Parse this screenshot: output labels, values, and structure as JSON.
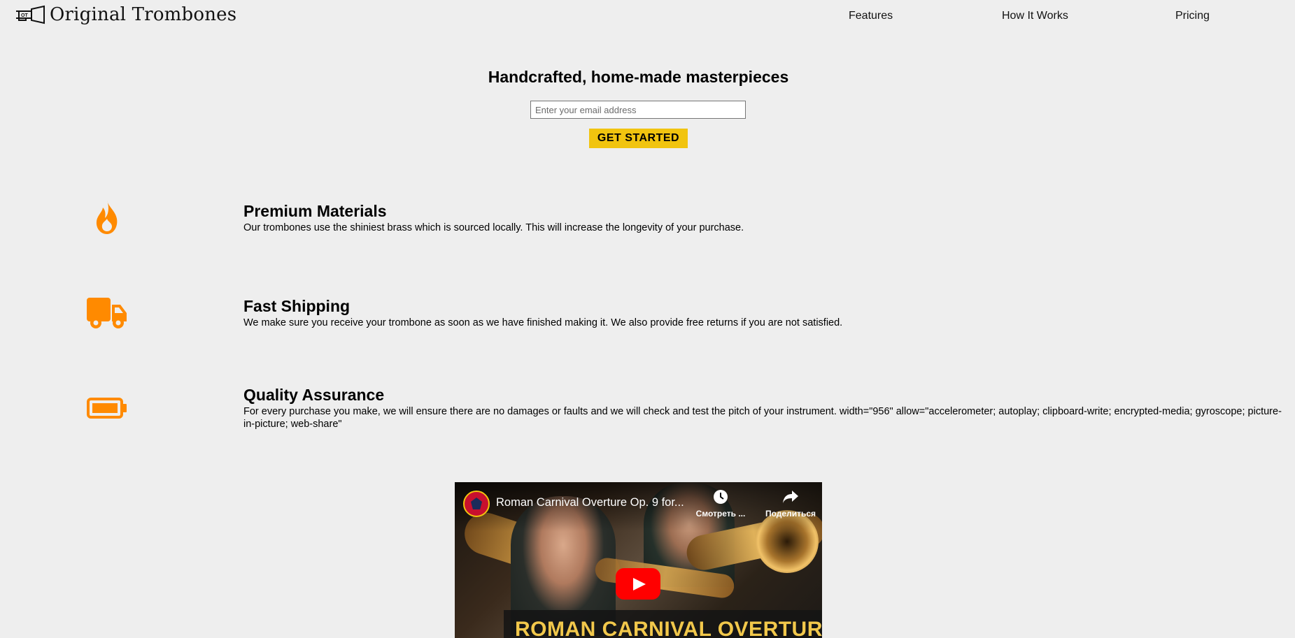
{
  "header": {
    "brand": "Original Trombones",
    "logo_icon": "trombone-icon",
    "nav": [
      {
        "label": "Features"
      },
      {
        "label": "How It Works"
      },
      {
        "label": "Pricing"
      }
    ]
  },
  "hero": {
    "title": "Handcrafted, home-made masterpieces",
    "email_placeholder": "Enter your email address",
    "cta_label": "GET STARTED",
    "cta_color": "#f1c40f"
  },
  "features": [
    {
      "icon": "fire-icon",
      "title": "Premium Materials",
      "text": "Our trombones use the shiniest brass which is sourced locally. This will increase the longevity of your purchase."
    },
    {
      "icon": "truck-icon",
      "title": "Fast Shipping",
      "text": "We make sure you receive your trombone as soon as we have finished making it. We also provide free returns if you are not satisfied."
    },
    {
      "icon": "battery-icon",
      "title": "Quality Assurance",
      "text": "For every purchase you make, we will ensure there are no damages or faults and we will check and test the pitch of your instrument. width=\"956\" allow=\"accelerometer; autoplay; clipboard-write; encrypted-media; gyroscope; picture-in-picture; web-share\""
    }
  ],
  "icon_color": "#ff8a00",
  "video": {
    "title": "Roman Carnival Overture Op. 9 for...",
    "watch_later": "Смотреть ...",
    "share": "Поделиться",
    "banner": "ROMAN CARNIVAL OVERTURE"
  }
}
